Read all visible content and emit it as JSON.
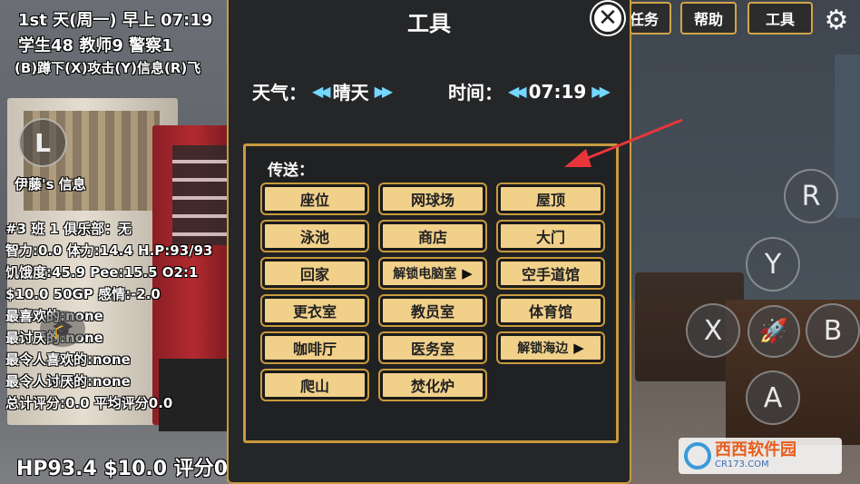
{
  "hud": {
    "date_time": "1st 天(周一) 早上 07:19",
    "people": "学生48 教师9 警察1",
    "controls": "(B)蹲下(X)攻击(Y)信息(R)飞",
    "l_button": "L",
    "character_info": "伊藤's 信息",
    "stats": [
      "#3 班 1 俱乐部：无",
      "智力:0.0 体力:14.4 H.P:93/93",
      "饥饿度:45.9 Pee:15.5 O2:1",
      "$10.0 50GP 感情:-2.0",
      "最喜欢的:none",
      "最讨厌的:none",
      "最令人喜欢的:none",
      "最令人讨厌的:none",
      "总计评分:0.0 平均评分0.0"
    ],
    "bottom_status": "HP93.4 $10.0 评分0"
  },
  "top_buttons": {
    "task": "任务",
    "help": "帮助",
    "tools": "工具"
  },
  "controller": {
    "r": "R",
    "y": "Y",
    "x": "X",
    "b": "B",
    "a": "A"
  },
  "panel": {
    "title": "工具",
    "weather_label": "天气：",
    "weather_value": "晴天",
    "time_label": "时间：",
    "time_value": "07:19",
    "teleport_label": "传送：",
    "locations": [
      {
        "label": "座位",
        "play": false
      },
      {
        "label": "网球场",
        "play": false
      },
      {
        "label": "屋顶",
        "play": false
      },
      {
        "label": "泳池",
        "play": false
      },
      {
        "label": "商店",
        "play": false
      },
      {
        "label": "大门",
        "play": false
      },
      {
        "label": "回家",
        "play": false
      },
      {
        "label": "解锁电脑室",
        "play": true
      },
      {
        "label": "空手道馆",
        "play": false
      },
      {
        "label": "更衣室",
        "play": false
      },
      {
        "label": "教员室",
        "play": false
      },
      {
        "label": "体育馆",
        "play": false
      },
      {
        "label": "咖啡厅",
        "play": false
      },
      {
        "label": "医务室",
        "play": false
      },
      {
        "label": "解锁海边",
        "play": true
      },
      {
        "label": "爬山",
        "play": false
      },
      {
        "label": "焚化炉",
        "play": false
      }
    ]
  },
  "watermark": {
    "title": "西西软件园",
    "url": "CR173.COM"
  },
  "colors": {
    "panel_border": "#c79a3e",
    "location_button": "#f1d08a",
    "arrow_accent": "#74d7ff",
    "annotation": "#e8353b"
  }
}
